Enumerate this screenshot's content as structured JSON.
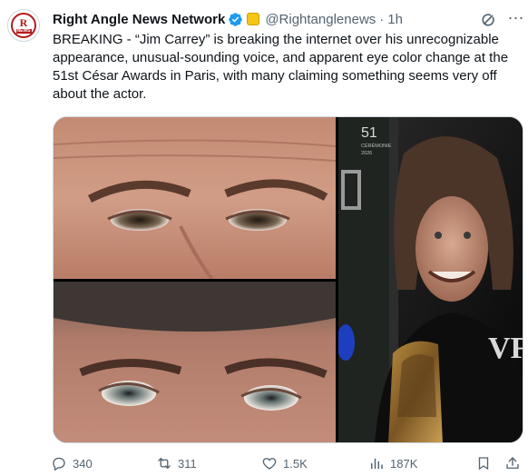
{
  "post": {
    "author_name": "Right Angle News Network",
    "handle": "@Rightanglenews",
    "separator": "·",
    "time": "1h",
    "avatar_text_big": "R",
    "avatar_text_small": "NEWS",
    "text": "BREAKING - “Jim Carrey” is breaking the internet over his unrecognizable appearance, unusual-sounding voice, and apparent eye color change at the 51st César Awards in Paris, with many claiming something seems very off about the actor.",
    "media": {
      "backdrop_text_51": "51",
      "backdrop_text_ceremonie": "CÉRÉMONIE",
      "backdrop_text_year": "2026",
      "backdrop_text_vf": "VF"
    },
    "actions": {
      "replies": "340",
      "reposts": "311",
      "likes": "1.5K",
      "views": "187K"
    }
  },
  "colors": {
    "verified": "#1d9bf0",
    "muted_text": "#536471",
    "brand_red": "#b31b1b"
  },
  "icons": [
    "verified-badge-icon",
    "affiliate-badge-icon",
    "grok-icon",
    "more-icon",
    "reply-icon",
    "repost-icon",
    "like-icon",
    "views-icon",
    "bookmark-icon",
    "share-icon"
  ]
}
